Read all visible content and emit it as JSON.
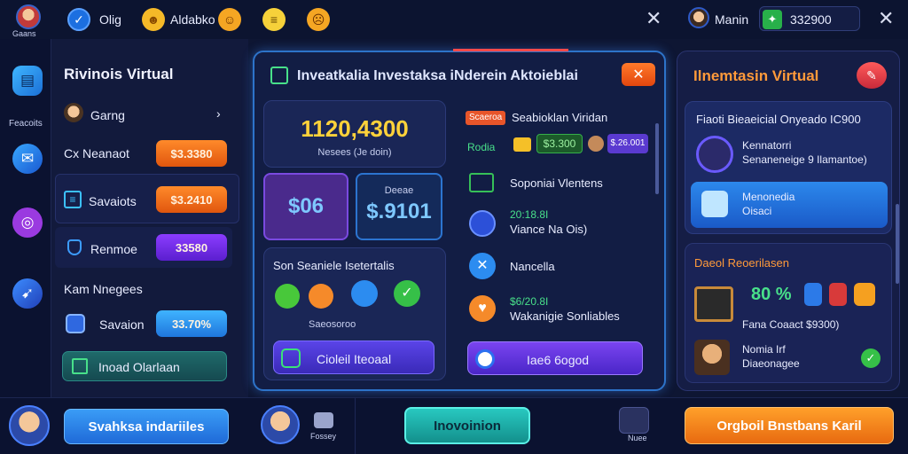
{
  "topbar": {
    "avatar_label": "Gaans",
    "item1": "Olig",
    "item2": "Aldabko",
    "user_name": "Manin",
    "balance": "332900",
    "close_label": "✕"
  },
  "rail": {
    "label": "Feacoits"
  },
  "leftpanel": {
    "title": "Rivinois Virtual",
    "rows": [
      {
        "label": "Garng"
      },
      {
        "label": "Cx Neanaot",
        "value": "$3.3380"
      },
      {
        "label": "Savaiots",
        "value": "$3.2410"
      },
      {
        "label": "Renmoe",
        "value": "33580"
      },
      {
        "label": "Kam Nnegees"
      },
      {
        "label": "Savaion",
        "value": "33.70%"
      }
    ],
    "bottom_button": "Inoad Olarlaan"
  },
  "center": {
    "title": "Inveatkalia Investaksa iNderein Aktoieblai",
    "big_number": "1120,4300",
    "big_sub": "Nesees (Je doin)",
    "stat1": "$06",
    "stat2_label": "Deeae",
    "stat2": "$.9101",
    "section_title": "Son Seaniele Isetertalis",
    "section_sub": "Saeosoroo",
    "action_btn": "Cioleil Iteoaal",
    "right_col": {
      "badge": "Scaeroa",
      "badge_text": "Seabioklan Viridan",
      "item1_label": "Rodia",
      "item1_v1": "$3.300",
      "item1_v2": "$.26.001",
      "item2": "Soponiai Vlentens",
      "item3_line1": "20:18.8I",
      "item3_line2": "Viance Na Ois)",
      "item4": "Nancella",
      "item5_line1": "$6/20.8I",
      "item5_line2": "Wakanigie Sonliables",
      "button": "Iae6 6ogod"
    }
  },
  "right": {
    "title": "Ilnemtasin Virtual",
    "card_title": "Fiaoti Bieaeicial Onyeado IC900",
    "item1_line1": "Kennatorri",
    "item1_line2": "Senaneneige 9 Ilamantoe)",
    "item2_line1": "Menonedia",
    "item2_line2": "Oisaci",
    "section_title": "Daeol Reoerilasen",
    "percent": "80 %",
    "fine_text": "Fana Coaact $9300)",
    "footer_line1": "Nomia Irf",
    "footer_line2": "Diaeonagee"
  },
  "bottombar": {
    "btn1": "Svahksa indariiles",
    "icon_label": "Fossey",
    "btn2": "Inovoinion",
    "icon2_label": "Nuee",
    "btn3": "Orgboil Bnstbans Karil"
  }
}
